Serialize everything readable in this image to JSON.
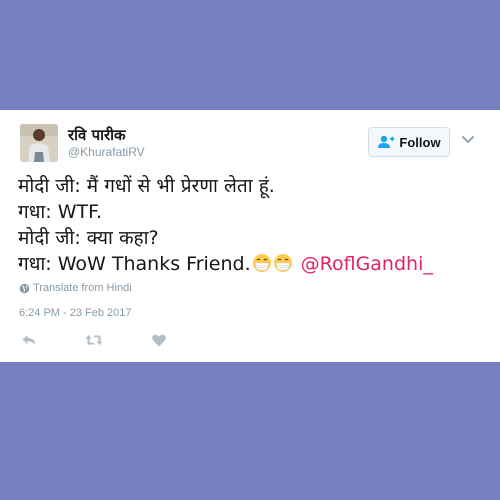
{
  "tweet": {
    "user": {
      "display_name": "रवि पारीक",
      "handle": "@KhurafatiRV",
      "avatar_icon": "user-avatar-photo"
    },
    "follow_button": {
      "label": "Follow",
      "icon": "add-user-icon"
    },
    "caret_icon": "chevron-down-icon",
    "text_lines": [
      "मोदी जी: मैं गधों से भी प्रेरणा लेता हूं.",
      "गधा: WTF.",
      "मोदी जी: क्या कहा?",
      "गधा: WoW Thanks Friend."
    ],
    "emojis": [
      "mask-face-emoji",
      "mask-face-emoji"
    ],
    "mention": "@RoflGandhi_",
    "translate_label": "Translate from Hindi",
    "timestamp": "6:24 PM - 23 Feb 2017",
    "actions": [
      "reply-icon",
      "retweet-icon",
      "like-icon"
    ]
  },
  "colors": {
    "background": "#7480c2",
    "mention": "#e0245e",
    "muted": "#8899a6",
    "follow_icon": "#1da1f2"
  }
}
